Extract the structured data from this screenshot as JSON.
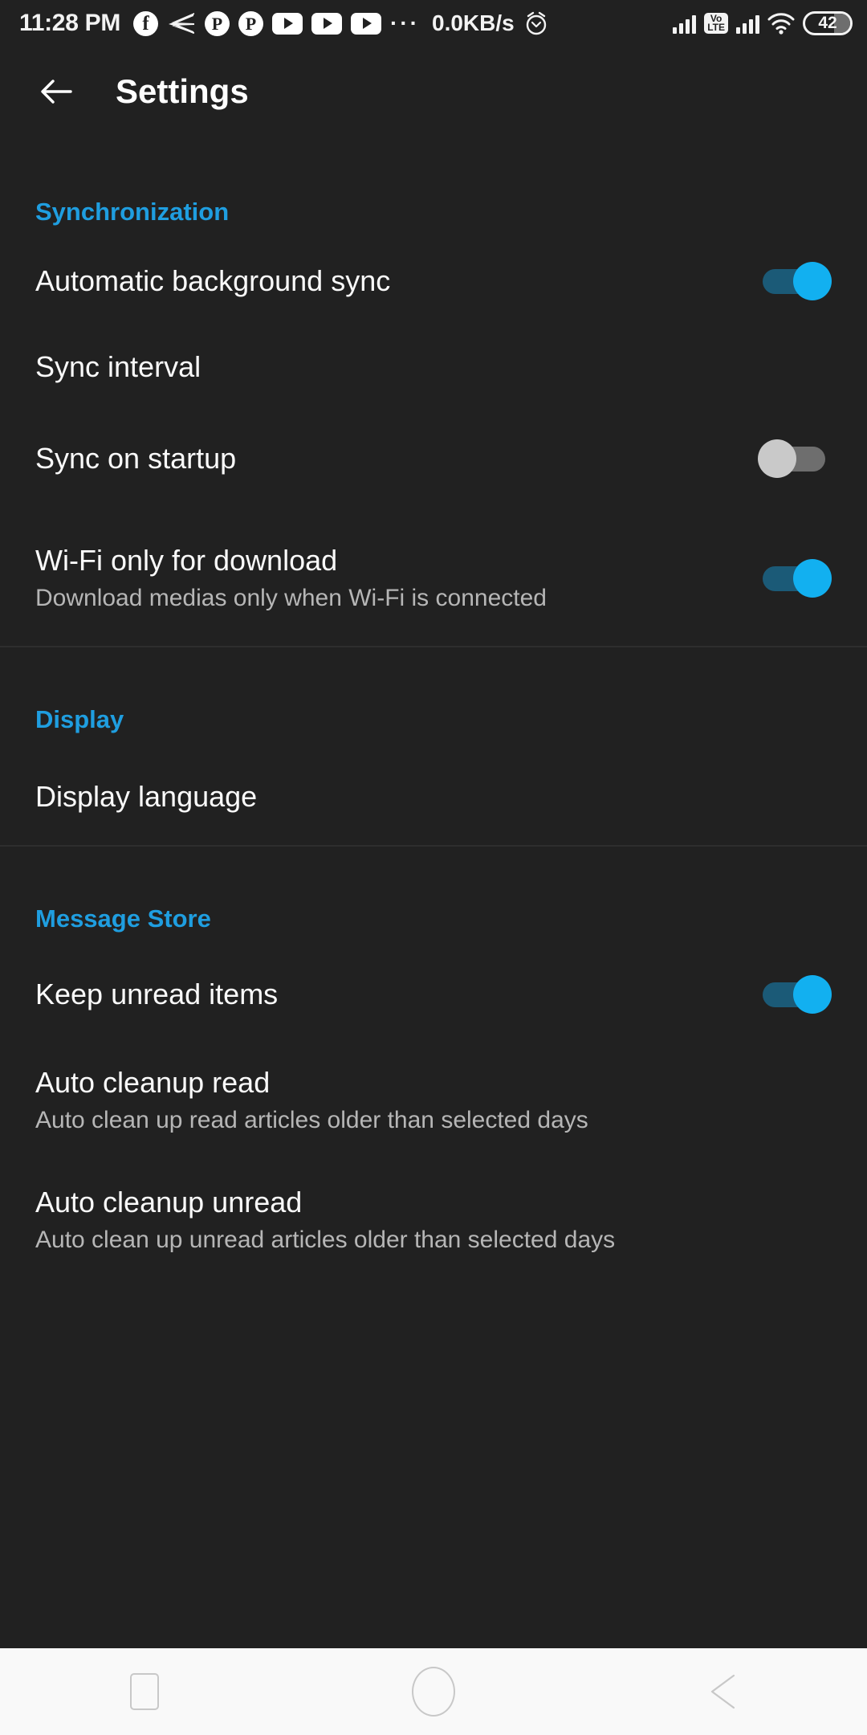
{
  "status_bar": {
    "time": "11:28 PM",
    "network_speed": "0.0KB/s",
    "overflow_dots": "···",
    "volte_line1": "Vo",
    "volte_line2": "LTE",
    "battery_level": "42",
    "notification_icons": [
      "facebook-icon",
      "messenger-icon",
      "pinterest-icon",
      "pinterest-icon",
      "youtube-icon",
      "youtube-icon",
      "youtube-icon"
    ],
    "facebook_glyph": "f",
    "pinterest_glyph": "P"
  },
  "app_bar": {
    "back_label": "Back",
    "title": "Settings"
  },
  "sections": [
    {
      "header": "Synchronization",
      "rows": [
        {
          "title": "Automatic background sync",
          "subtitle": "",
          "switch": "on"
        },
        {
          "title": "Sync interval",
          "subtitle": "",
          "switch": "none"
        },
        {
          "title": "Sync on startup",
          "subtitle": "",
          "switch": "off"
        },
        {
          "title": "Wi-Fi only for download",
          "subtitle": "Download medias only when Wi-Fi is connected",
          "switch": "on"
        }
      ]
    },
    {
      "header": "Display",
      "rows": [
        {
          "title": "Display language",
          "subtitle": "",
          "switch": "none"
        }
      ]
    },
    {
      "header": "Message Store",
      "rows": [
        {
          "title": "Keep unread items",
          "subtitle": "",
          "switch": "on"
        },
        {
          "title": "Auto cleanup read",
          "subtitle": "Auto clean up read articles older than selected days",
          "switch": "none"
        },
        {
          "title": "Auto cleanup unread",
          "subtitle": "Auto clean up unread articles older than selected days",
          "switch": "none"
        }
      ]
    }
  ],
  "nav_bar": {
    "recents_label": "Recents",
    "home_label": "Home",
    "back_label": "Back"
  },
  "colors": {
    "background": "#212121",
    "accent_blue": "#1f9ee0",
    "switch_on_thumb": "#12b0f0",
    "switch_on_track": "#1b5a77",
    "switch_off_thumb": "#c9c9c9",
    "switch_off_track": "#6e6e6e",
    "primary_text": "#fafafa",
    "secondary_text": "#b6b6b6",
    "nav_bar_bg": "#f9f9f9"
  }
}
